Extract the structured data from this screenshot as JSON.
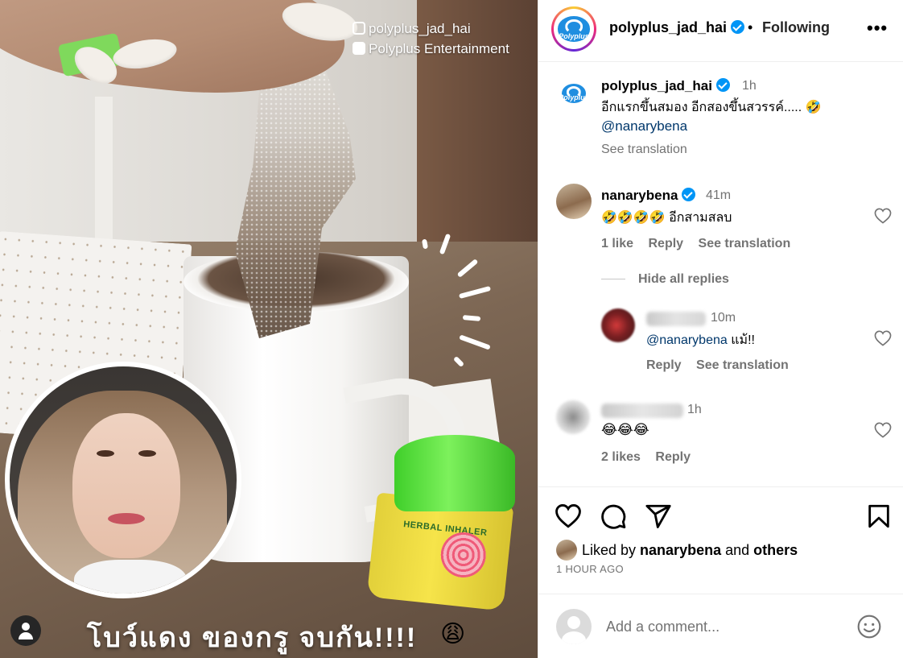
{
  "media": {
    "watermark_instagram": "polyplus_jad_hai",
    "watermark_facebook": "Polyplus Entertainment",
    "overlay_caption": "โบว์แดง ของกรู จบกัน!!!!",
    "overlay_emoji": "😩",
    "inhaler_label": "HERBAL INHALER"
  },
  "header": {
    "username": "polyplus_jad_hai",
    "logo_text": "Polyplus",
    "separator": "•",
    "follow_status": "Following",
    "more_label": "•••"
  },
  "caption": {
    "username": "polyplus_jad_hai",
    "time": "1h",
    "text": "อีกแรกขึ้นสมอง อีกสองขึ้นสวรรค์..... 🤣",
    "mention": "@nanarybena",
    "see_translation": "See translation"
  },
  "comments": [
    {
      "username": "nanarybena",
      "time": "41m",
      "text": "🤣🤣🤣🤣 อีกสามสลบ",
      "likes": "1 like",
      "reply": "Reply",
      "see_translation": "See translation"
    },
    {
      "time": "10m",
      "mention": "@nanarybena",
      "text": " แม้!!",
      "reply": "Reply",
      "see_translation": "See translation"
    },
    {
      "time": "1h",
      "text": "😂😂😂",
      "likes": "2 likes",
      "reply": "Reply"
    }
  ],
  "hide_replies": "Hide all replies",
  "likes_summary": {
    "prefix": "Liked by ",
    "user": "nanarybena",
    "middle": " and ",
    "others": "others"
  },
  "time_ago": "1 HOUR AGO",
  "comment_input": {
    "placeholder": "Add a comment..."
  }
}
